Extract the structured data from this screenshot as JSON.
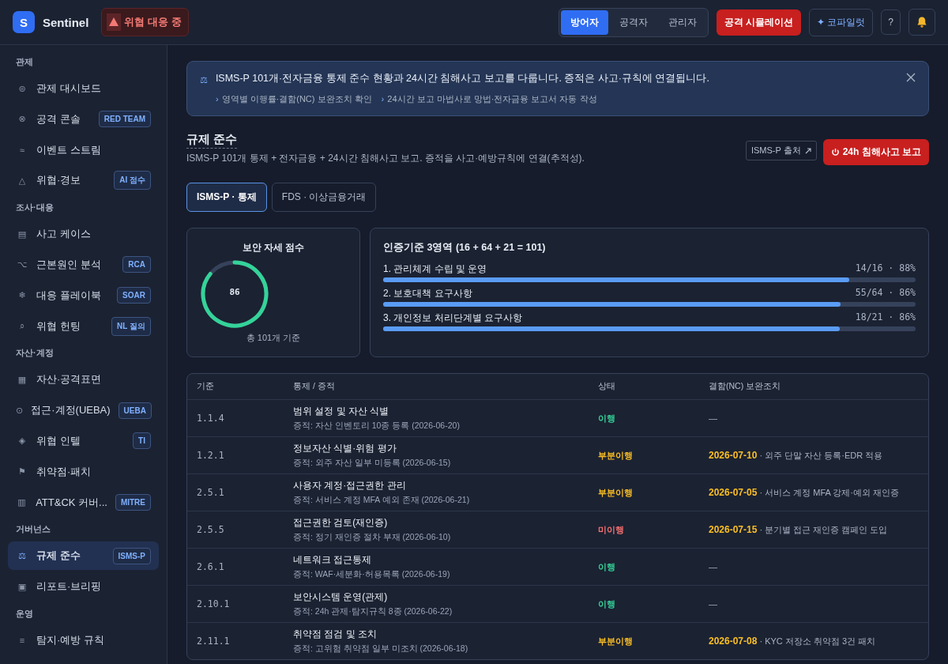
{
  "header": {
    "logo_letter": "S",
    "brand": "Sentinel",
    "alert_badge": "위협 대응 중",
    "modes": [
      {
        "label": "방어자",
        "selected": true
      },
      {
        "label": "공격자",
        "selected": false
      },
      {
        "label": "관리자",
        "selected": false
      }
    ],
    "simulate_button": "공격 시뮬레이션",
    "copilot_button": "코파일럿",
    "copilot_icon": "✦",
    "help_button": "?"
  },
  "sidebar": {
    "sections": [
      {
        "title": "관제",
        "items": [
          {
            "icon": "⊚",
            "label": "관제 대시보드",
            "selected": false
          },
          {
            "icon": "⊗",
            "label": "공격 콘솔",
            "badge": "RED TEAM",
            "selected": false
          },
          {
            "icon": "≈",
            "label": "이벤트 스트림",
            "selected": false
          },
          {
            "icon": "△",
            "label": "위협·경보",
            "badge": "AI 점수",
            "selected": false
          }
        ]
      },
      {
        "title": "조사·대응",
        "items": [
          {
            "icon": "▤",
            "label": "사고 케이스",
            "selected": false
          },
          {
            "icon": "⌥",
            "label": "근본원인 분석",
            "badge": "RCA",
            "selected": false
          },
          {
            "icon": "❄",
            "label": "대응 플레이북",
            "badge": "SOAR",
            "selected": false
          },
          {
            "icon": "⌕",
            "label": "위협 헌팅",
            "badge": "NL 질의",
            "selected": false
          }
        ]
      },
      {
        "title": "자산·계정",
        "items": [
          {
            "icon": "▦",
            "label": "자산·공격표면",
            "selected": false
          },
          {
            "icon": "⊙",
            "label": "접근·계정(UEBA)",
            "badge": "UEBA",
            "selected": false
          },
          {
            "icon": "◈",
            "label": "위협 인텔",
            "badge": "TI",
            "selected": false
          },
          {
            "icon": "⚑",
            "label": "취약점·패치",
            "selected": false
          },
          {
            "icon": "▥",
            "label": "ATT&CK 커버...",
            "badge": "MITRE",
            "selected": false
          }
        ]
      },
      {
        "title": "거버넌스",
        "items": [
          {
            "icon": "⚖",
            "label": "규제 준수",
            "badge": "ISMS-P",
            "selected": true
          },
          {
            "icon": "▣",
            "label": "리포트·브리핑",
            "selected": false
          }
        ]
      },
      {
        "title": "운영",
        "items": [
          {
            "icon": "≡",
            "label": "탐지·예방 규칙",
            "selected": false
          }
        ]
      }
    ]
  },
  "banner": {
    "icon": "⚖",
    "text": "ISMS-P 101개·전자금융 통제 준수 현황과 24시간 침해사고 보고를 다룹니다. 증적은 사고·규칙에 연결됩니다.",
    "links": [
      {
        "arrow": "›",
        "label": "영역별 이행률·결함(NC) 보완조치 확인"
      },
      {
        "arrow": "›",
        "label": "24시간 보고 마법사로 망법·전자금융 보고서 자동 작성"
      }
    ]
  },
  "page": {
    "title": "규제 준수",
    "subtitle": "ISMS-P 101개 통제 + 전자금융 + 24시간 침해사고 보고. 증적을 사고·예방규칙에 연결(추적성).",
    "source_button": "ISMS-P 출처",
    "report_button": "24h 침해사고 보고"
  },
  "tabs": [
    {
      "label": "ISMS-P · 통제",
      "selected": true
    },
    {
      "label": "FDS · 이상금융거래",
      "selected": false
    }
  ],
  "score_card": {
    "title": "보안 자세 점수",
    "value": "86",
    "level": 0.86,
    "caption": "총 101개 기준"
  },
  "domains": {
    "title": "인증기준 3영역 (16 + 64 + 21 = 101)",
    "items": [
      {
        "label": "1. 관리체계 수립 및 운영",
        "reading": "14/16 · 88%",
        "level": 0.875
      },
      {
        "label": "2. 보호대책 요구사항",
        "reading": "55/64 · 86%",
        "level": 0.859
      },
      {
        "label": "3. 개인정보 처리단계별 요구사항",
        "reading": "18/21 · 86%",
        "level": 0.857
      }
    ]
  },
  "table": {
    "columns": [
      "기준",
      "통제 / 증적",
      "상태",
      "결함(NC) 보완조치"
    ],
    "rows": [
      {
        "code": "1.1.4",
        "control": "범위 설정 및 자산 식별",
        "evidence": "증적: 자산 인벤토리 10종 등록 (2026-06-20)",
        "status": "이행",
        "kind": "met",
        "remediation": "—"
      },
      {
        "code": "1.2.1",
        "control": "정보자산 식별·위험 평가",
        "evidence": "증적: 외주 자산 일부 미등록 (2026-06-15)",
        "status": "부분이행",
        "kind": "partial",
        "due": "2026-07-10",
        "remediation": "· 외주 단말 자산 등록·EDR 적용"
      },
      {
        "code": "2.5.1",
        "control": "사용자 계정·접근권한 관리",
        "evidence": "증적: 서비스 계정 MFA 예외 존재 (2026-06-21)",
        "status": "부분이행",
        "kind": "partial",
        "due": "2026-07-05",
        "remediation": "· 서비스 계정 MFA 강제·예외 재인증"
      },
      {
        "code": "2.5.5",
        "control": "접근권한 검토(재인증)",
        "evidence": "증적: 정기 재인증 절차 부재 (2026-06-10)",
        "status": "미이행",
        "kind": "unmet",
        "due": "2026-07-15",
        "remediation": "· 분기별 접근 재인증 캠페인 도입"
      },
      {
        "code": "2.6.1",
        "control": "네트워크 접근통제",
        "evidence": "증적: WAF·세분화·허용목록 (2026-06-19)",
        "status": "이행",
        "kind": "met",
        "remediation": "—"
      },
      {
        "code": "2.10.1",
        "control": "보안시스템 운영(관제)",
        "evidence": "증적: 24h 관제·탐지규칙 8종 (2026-06-22)",
        "status": "이행",
        "kind": "met",
        "remediation": "—"
      },
      {
        "code": "2.11.1",
        "control": "취약점 점검 및 조치",
        "evidence": "증적: 고위험 취약점 일부 미조치 (2026-06-18)",
        "status": "부분이행",
        "kind": "partial",
        "due": "2026-07-08",
        "remediation": "· KYC 저장소 취약점 3건 패치"
      }
    ]
  }
}
